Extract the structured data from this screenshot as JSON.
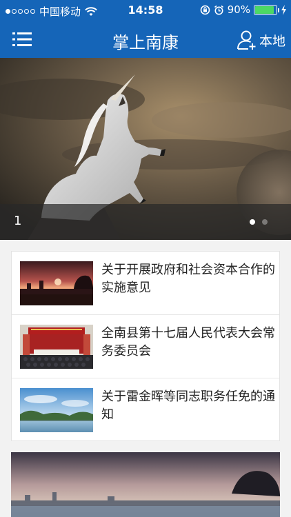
{
  "status_bar": {
    "carrier": "中国移动",
    "time": "14:58",
    "battery_percent": "90%",
    "battery_level": 0.9,
    "signal_bars_filled": 1,
    "signal_bars_total": 5,
    "icons": [
      "wifi-icon",
      "rotation-lock-icon",
      "alarm-icon",
      "battery-icon",
      "charging-icon"
    ]
  },
  "nav": {
    "title": "掌上南康",
    "menu_icon": "list-menu-icon",
    "local_icon": "user-add-icon",
    "local_label": "本地"
  },
  "banner": {
    "index_label": "1",
    "page_count": 2,
    "active_page": 1
  },
  "news": [
    {
      "title": "关于开展政府和社会资本合作的实施意见",
      "thumb": "sunset-city-photo"
    },
    {
      "title": "全南县第十七届人民代表大会常务委员会",
      "thumb": "conference-hall-photo"
    },
    {
      "title": "关于雷金晖等同志职务任免的通知",
      "thumb": "lake-mountains-photo"
    }
  ],
  "colors": {
    "accent": "#1565b8",
    "battery": "#4cd964"
  }
}
